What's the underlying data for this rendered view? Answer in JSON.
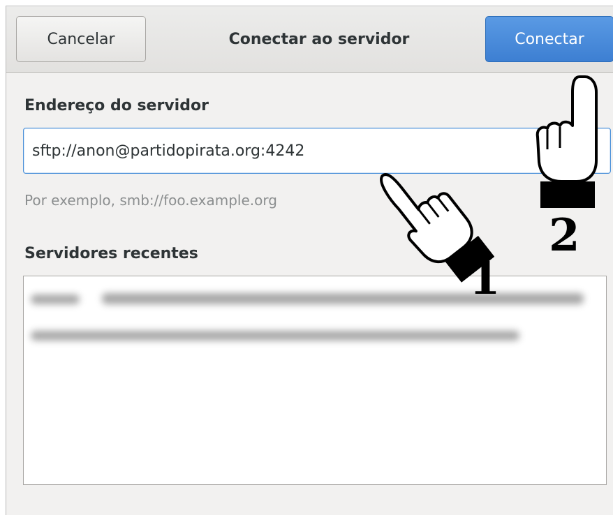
{
  "dialog": {
    "title": "Conectar ao servidor",
    "cancel_label": "Cancelar",
    "connect_label": "Conectar"
  },
  "address": {
    "label": "Endereço do servidor",
    "value": "sftp://anon@partidopirata.org:4242",
    "hint": "Por exemplo, smb://foo.example.org"
  },
  "recent": {
    "label": "Servidores recentes",
    "items_note": "blurred"
  },
  "annotations": {
    "step1": "1",
    "step2": "2"
  },
  "colors": {
    "accent": "#4a90d9",
    "connect_bg": "#3d7fd2",
    "window_bg": "#f2f1f0"
  },
  "icons": {
    "clear": "edit-clear-icon",
    "pointer": "pointing-hand-icon"
  }
}
